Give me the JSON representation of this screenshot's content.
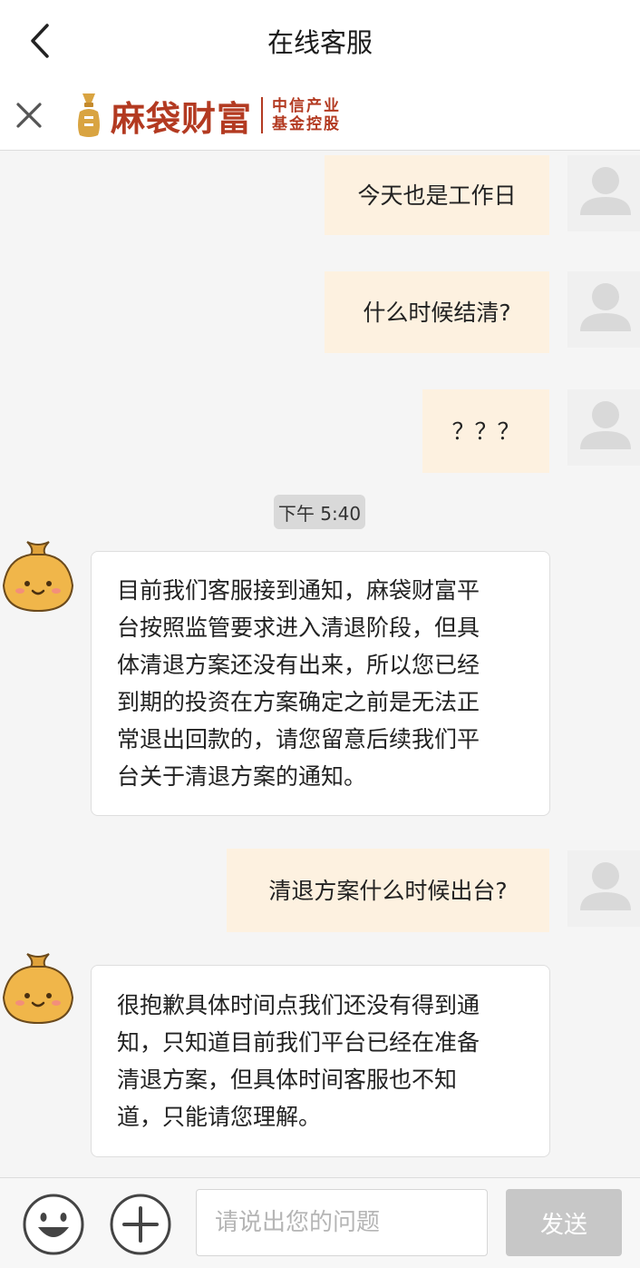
{
  "header": {
    "title": "在线客服",
    "back_icon": "chevron-left-icon"
  },
  "brand": {
    "close_icon": "close-icon",
    "name": "麻袋财富",
    "sub_line1": "中信产业",
    "sub_line2": "基金控股",
    "color": "#b33a21"
  },
  "messages": [
    {
      "role": "user",
      "text": "今天也是工作日"
    },
    {
      "role": "user",
      "text": "什么时候结清?"
    },
    {
      "role": "user",
      "text": "？？？"
    },
    {
      "role": "time",
      "text": "下午 5:40"
    },
    {
      "role": "agent",
      "lines": [
        "目前我们客服接到通知，麻袋财富平",
        "台按照监管要求进入清退阶段，但具",
        "体清退方案还没有出来，所以您已经",
        "到期的投资在方案确定之前是无法正",
        "常退出回款的，请您留意后续我们平",
        "台关于清退方案的通知。"
      ]
    },
    {
      "role": "user",
      "text": "清退方案什么时候出台?"
    },
    {
      "role": "agent",
      "lines": [
        "很抱歉具体时间点我们还没有得到通",
        "知，只知道目前我们平台已经在准备",
        "清退方案，但具体时间客服也不知",
        "道，只能请您理解。"
      ]
    }
  ],
  "input_bar": {
    "emoji_icon": "emoji-smile-icon",
    "plus_icon": "plus-circle-icon",
    "placeholder": "请说出您的问题",
    "value": "",
    "send_label": "发送"
  },
  "colors": {
    "user_bubble": "#fdf1e0",
    "agent_bubble": "#ffffff",
    "background": "#f5f5f5",
    "send_disabled": "#c7c7c7"
  }
}
